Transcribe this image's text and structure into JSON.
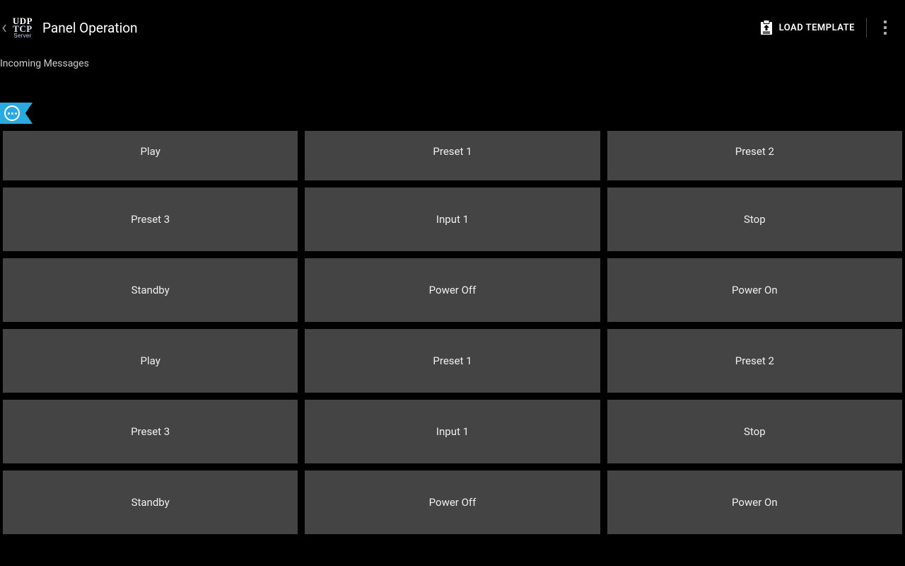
{
  "header": {
    "logo_line1": "UDP",
    "logo_line2": "TCP",
    "logo_line3": "Server",
    "title": "Panel Operation",
    "load_template_label": "LOAD TEMPLATE"
  },
  "incoming_label": "Incoming Messages",
  "buttons": [
    "Play",
    "Preset 1",
    "Preset 2",
    "Preset 3",
    "Input 1",
    "Stop",
    "Standby",
    "Power Off",
    "Power On",
    "Play",
    "Preset 1",
    "Preset 2",
    "Preset 3",
    "Input 1",
    "Stop",
    "Standby",
    "Power Off",
    "Power On"
  ]
}
